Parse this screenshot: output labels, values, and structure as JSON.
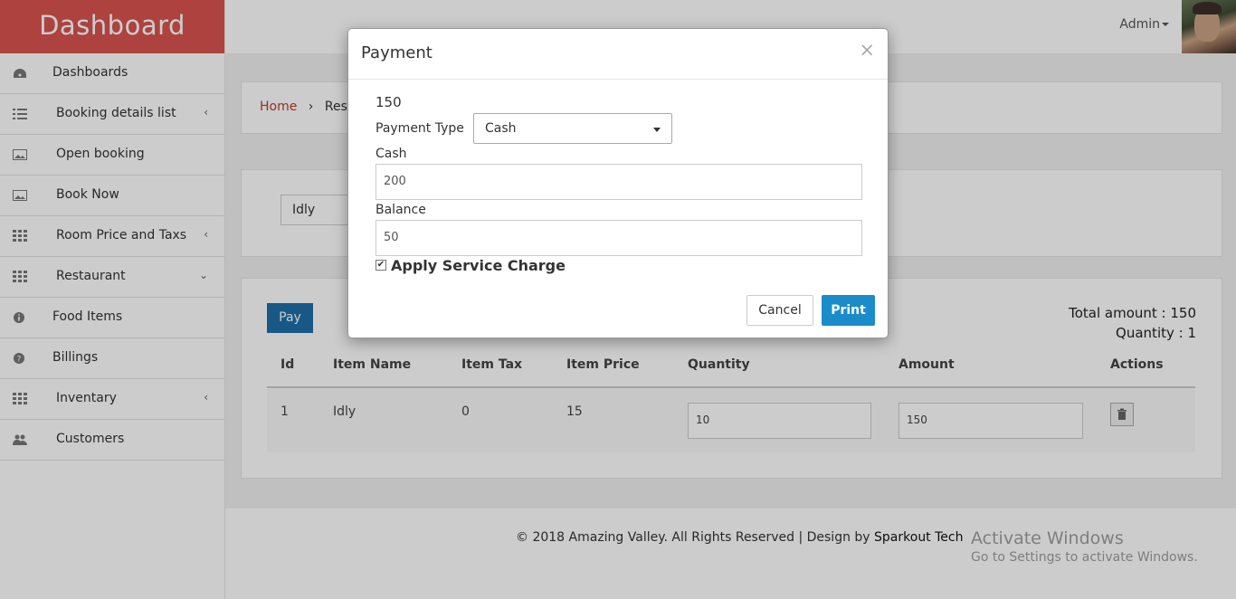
{
  "brand": {
    "title": "Dashboard"
  },
  "sidebar": {
    "items": [
      {
        "label": "Dashboards",
        "icon": "dashboard-icon",
        "arrow": ""
      },
      {
        "label": "Booking details list",
        "icon": "list-icon",
        "arrow": "‹"
      },
      {
        "label": "Open booking",
        "icon": "image-icon",
        "arrow": ""
      },
      {
        "label": "Book Now",
        "icon": "image-icon",
        "arrow": ""
      },
      {
        "label": "Room Price and Taxs",
        "icon": "grid-icon",
        "arrow": "‹"
      },
      {
        "label": "Restaurant",
        "icon": "grid-icon",
        "arrow": "⌄"
      },
      {
        "label": "Food Items",
        "icon": "info-icon",
        "arrow": ""
      },
      {
        "label": "Billings",
        "icon": "question-icon",
        "arrow": ""
      },
      {
        "label": "Inventary",
        "icon": "grid-icon",
        "arrow": "‹"
      },
      {
        "label": "Customers",
        "icon": "users-icon",
        "arrow": ""
      }
    ]
  },
  "topbar": {
    "user_label": "Admin"
  },
  "breadcrumb": {
    "home": "Home",
    "separator": "›",
    "current": "Rest"
  },
  "order": {
    "item_select": "Idly",
    "pay_label": "Pay",
    "total_amount": "Total amount : 150",
    "quantity": "Quantity : 1",
    "columns": [
      "Id",
      "Item Name",
      "Item Tax",
      "Item Price",
      "Quantity",
      "Amount",
      "Actions"
    ],
    "rows": [
      {
        "id": "1",
        "name": "Idly",
        "tax": "0",
        "price": "15",
        "quantity": "10",
        "amount": "150"
      }
    ]
  },
  "footer": {
    "text": "© 2018 Amazing Valley. All Rights Reserved | Design by ",
    "designer": "Sparkout Tech"
  },
  "windows_watermark": {
    "title": "Activate Windows",
    "subtitle": "Go to Settings to activate Windows."
  },
  "modal": {
    "title": "Payment",
    "close": "×",
    "amount": "150",
    "payment_type_label": "Payment Type",
    "payment_type_value": "Cash",
    "cash_label": "Cash",
    "cash_value": "200",
    "balance_label": "Balance",
    "balance_value": "50",
    "service_charge_label": "Apply Service Charge",
    "service_charge_checked": true,
    "cancel_label": "Cancel",
    "print_label": "Print"
  },
  "colors": {
    "brand": "#d9534f",
    "primary": "#1a8cc9",
    "pay": "#1f6fa8"
  }
}
